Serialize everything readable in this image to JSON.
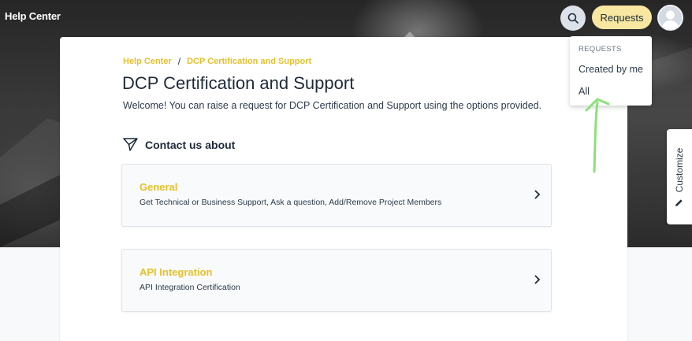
{
  "header": {
    "site_title": "Help Center",
    "requests_label": "Requests"
  },
  "breadcrumb": {
    "home": "Help Center",
    "separator": "/",
    "current": "DCP Certification and Support"
  },
  "page": {
    "title": "DCP Certification and Support",
    "welcome": "Welcome! You can raise a request for DCP Certification and Support using the options provided.",
    "contact_label": "Contact us about"
  },
  "options": [
    {
      "title": "General",
      "description": "Get Technical or Business Support, Ask a question, Add/Remove Project Members"
    },
    {
      "title": "API Integration",
      "description": "API Integration Certification"
    }
  ],
  "requests_menu": {
    "header": "REQUESTS",
    "items": [
      "Created by me",
      "All"
    ]
  },
  "customize": {
    "label": "Customize"
  },
  "colors": {
    "accent": "#e8bf2a",
    "requests_button": "#f8e7a0",
    "annotation_arrow": "#8ee07a"
  },
  "icons": {
    "search": "search-icon",
    "avatar": "user-avatar-icon",
    "contact": "paper-plane-icon",
    "chevron": "chevron-right-icon",
    "customize": "pencil-icon"
  }
}
